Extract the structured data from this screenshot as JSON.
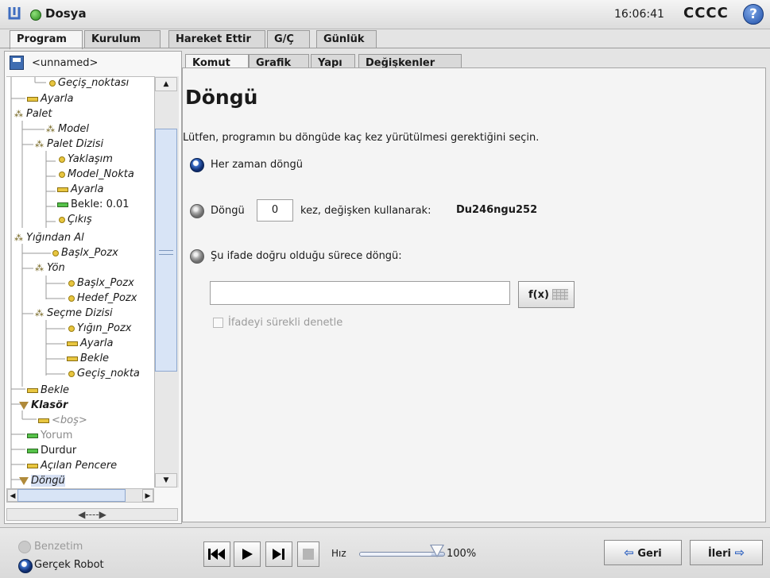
{
  "app": {
    "title": "Dosya",
    "clock": "16:06:41",
    "robot_name": "CCCC",
    "help": "?"
  },
  "main_tabs": [
    "Program",
    "Kurulum",
    "Hareket Ettir",
    "G/Ç",
    "Günlük"
  ],
  "program_file": "<unnamed>",
  "tree": [
    {
      "label": "Geçiş_noktası",
      "icon": "waypoint"
    },
    {
      "label": "Ayarla",
      "icon": "set"
    },
    {
      "label": "Palet",
      "icon": "pallet"
    },
    {
      "label": "Model",
      "icon": "pallet"
    },
    {
      "label": "Palet Dizisi",
      "icon": "pallet"
    },
    {
      "label": "Yaklaşım",
      "icon": "waypoint"
    },
    {
      "label": "Model_Nokta",
      "icon": "waypoint"
    },
    {
      "label": "Ayarla",
      "icon": "set"
    },
    {
      "label": "Bekle: 0.01",
      "icon": "wait"
    },
    {
      "label": "Çıkış",
      "icon": "waypoint"
    },
    {
      "label": "Yığından Al",
      "icon": "pallet"
    },
    {
      "label": "Başlx_Pozx",
      "icon": "waypoint"
    },
    {
      "label": "Yön",
      "icon": "pallet"
    },
    {
      "label": "Başlx_Pozx",
      "icon": "waypoint"
    },
    {
      "label": "Hedef_Pozx",
      "icon": "waypoint"
    },
    {
      "label": "Seçme Dizisi",
      "icon": "pallet"
    },
    {
      "label": "Yığın_Pozx",
      "icon": "waypoint"
    },
    {
      "label": "Ayarla",
      "icon": "set"
    },
    {
      "label": "Bekle",
      "icon": "set"
    },
    {
      "label": "Geçiş_nokta",
      "icon": "waypoint"
    },
    {
      "label": "Bekle",
      "icon": "set"
    },
    {
      "label": "Klasör",
      "icon": "folder"
    },
    {
      "label": "<boş>",
      "icon": "set"
    },
    {
      "label": "Yorum",
      "icon": "comment"
    },
    {
      "label": "Durdur",
      "icon": "halt"
    },
    {
      "label": "Açılan Pencere",
      "icon": "set"
    },
    {
      "label": "Döngü",
      "icon": "loop"
    }
  ],
  "sub_tabs": [
    "Komut",
    "Grafik",
    "Yapı",
    "Değişkenler"
  ],
  "panel": {
    "heading": "Döngü",
    "instruction": "Lütfen, programın bu döngüde kaç kez yürütülmesi gerektiğini seçin.",
    "opt_always": "Her zaman döngü",
    "opt_count_prefix": "Döngü",
    "count_value": "0",
    "opt_count_suffix": "kez, değişken kullanarak:",
    "variable_name": "Du246ngu252",
    "opt_expr": "Şu ifade doğru olduğu sürece döngü:",
    "expr_value": "",
    "fx_label": "f(x)",
    "checkbox_label": "İfadeyi sürekli denetle"
  },
  "bottom": {
    "simulation_label": "Benzetim",
    "real_robot_label": "Gerçek Robot",
    "speed_label": "Hız",
    "speed_value": "100%",
    "speed_level": 1.0,
    "back_label": "Geri",
    "next_label": "İleri"
  }
}
